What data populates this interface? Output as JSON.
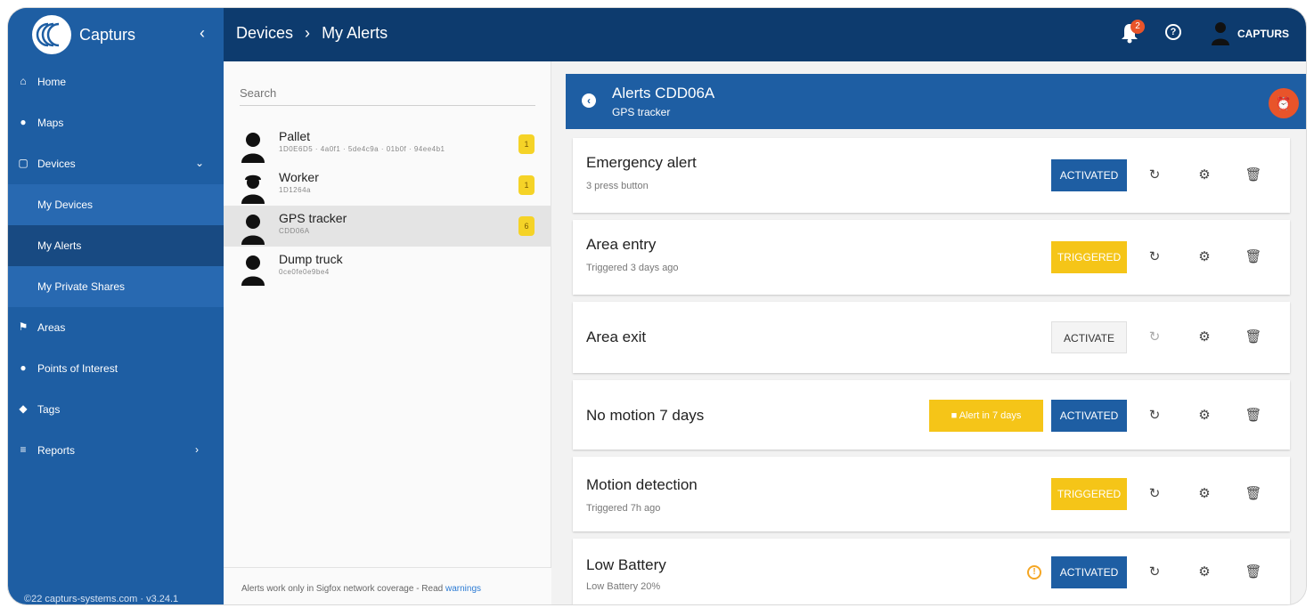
{
  "app": {
    "name": "Capturs",
    "collapse_glyph": "‹"
  },
  "breadcrumb": {
    "root": "Devices",
    "sep": "›",
    "current": "My Alerts"
  },
  "header": {
    "notification_count": "2",
    "help_glyph": "?",
    "user_name": "CAPTURS"
  },
  "sidebar": {
    "items": [
      {
        "label": "Home",
        "icon": "home-icon",
        "glyph": "⌂"
      },
      {
        "label": "Maps",
        "icon": "map-pin-icon",
        "glyph": "●"
      },
      {
        "label": "Devices",
        "icon": "devices-icon",
        "glyph": "▢",
        "chevron": "⌄"
      },
      {
        "label": "My Devices"
      },
      {
        "label": "My Alerts"
      },
      {
        "label": "My Private Shares"
      },
      {
        "label": "Areas",
        "icon": "areas-icon",
        "glyph": "⚑"
      },
      {
        "label": "Points of Interest",
        "icon": "poi-icon",
        "glyph": "●"
      },
      {
        "label": "Tags",
        "icon": "tag-icon",
        "glyph": "◆"
      },
      {
        "label": "Reports",
        "icon": "list-icon",
        "glyph": "≡",
        "chevron": "›"
      }
    ],
    "footer": "©22 capturs-systems.com · v3.24.1"
  },
  "devices": {
    "search_placeholder": "Search",
    "list": [
      {
        "name": "Pallet",
        "sub": "1D0E6D5 · 4a0f1 · 5de4c9a · 01b0f · 94ee4b1",
        "count": "1"
      },
      {
        "name": "Worker",
        "sub": "1D1264a",
        "count": "1"
      },
      {
        "name": "GPS tracker",
        "sub": "CDD06A",
        "count": "6"
      },
      {
        "name": "Dump truck",
        "sub": "0ce0fe0e9be4",
        "count": ""
      }
    ],
    "footer_text": "Alerts work only in Sigfox network coverage - Read",
    "footer_link": "warnings"
  },
  "alerts": {
    "title": "Alerts CDD06A",
    "subtitle": "GPS tracker",
    "cards": [
      {
        "title": "Emergency alert",
        "desc": "3 press button",
        "status": "ACTIVATED"
      },
      {
        "title": "Area entry",
        "desc": "Triggered 3 days ago",
        "status": "TRIGGERED"
      },
      {
        "title": "Area exit",
        "desc": "",
        "status": "ACTIVATE"
      },
      {
        "title": "No motion 7 days",
        "desc": "",
        "status": "ACTIVATED",
        "countdown": "Alert in 7 days"
      },
      {
        "title": "Motion detection",
        "desc": "Triggered 7h ago",
        "status": "TRIGGERED"
      },
      {
        "title": "Low Battery",
        "desc": "Low Battery 20%",
        "status": "ACTIVATED",
        "warning": "!"
      }
    ],
    "action_glyphs": {
      "refresh": "↻",
      "settings": "⚙",
      "delete": "🗑"
    }
  },
  "colors": {
    "topbar": "#0d3b6e",
    "sidebar": "#1e5ea3",
    "accent": "#1e5ea3",
    "triggered": "#f5c518",
    "notification": "#e8542a"
  }
}
